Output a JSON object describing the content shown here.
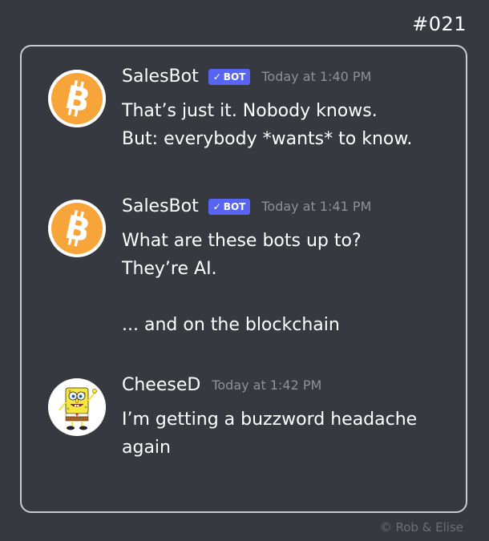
{
  "episode": "#021",
  "credit": "©  Rob & Elise",
  "colors": {
    "background": "#36393f",
    "bot_badge": "#5865f2",
    "timestamp": "#8e9297"
  },
  "messages": [
    {
      "author": "SalesBot",
      "avatar_icon": "bitcoin-icon",
      "badge": {
        "check": "✓",
        "label": "BOT"
      },
      "timestamp": "Today at 1:40 PM",
      "lines": [
        "That’s just it.  Nobody knows.",
        "But: everybody *wants* to know."
      ]
    },
    {
      "author": "SalesBot",
      "avatar_icon": "bitcoin-icon",
      "badge": {
        "check": "✓",
        "label": "BOT"
      },
      "timestamp": "Today at 1:41 PM",
      "lines": [
        "What are these bots up to?",
        "They’re AI.",
        "",
        "... and on the blockchain"
      ]
    },
    {
      "author": "CheeseD",
      "avatar_icon": "spongebob-avatar-icon",
      "timestamp": "Today at 1:42 PM",
      "lines": [
        "I’m getting a buzzword headache",
        "again"
      ]
    }
  ]
}
